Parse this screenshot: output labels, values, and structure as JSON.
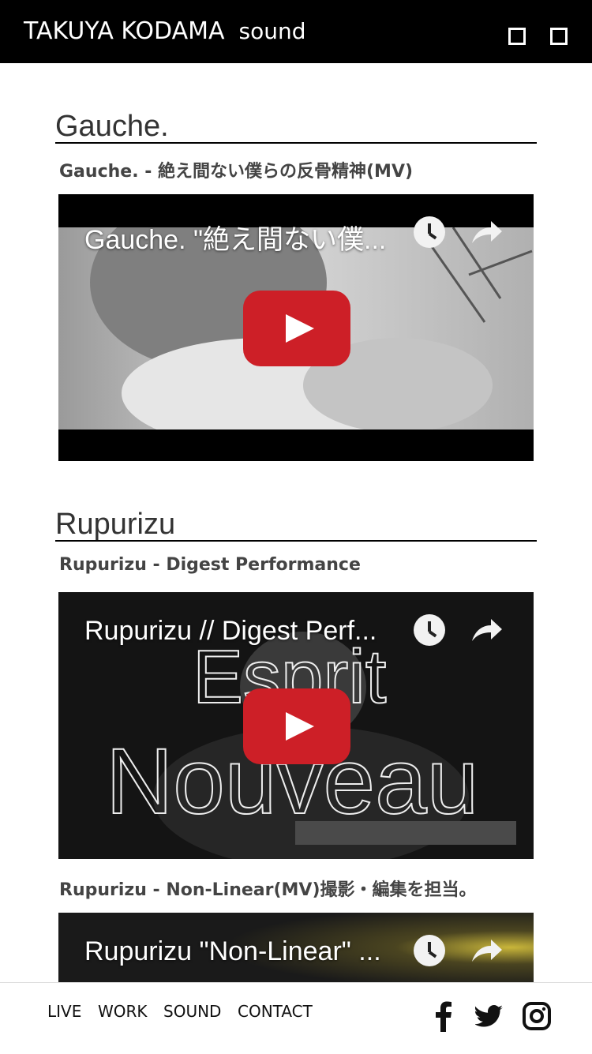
{
  "header": {
    "brand": "TAKUYA KODAMA",
    "sub": "sound"
  },
  "sections": [
    {
      "title": "Gauche.",
      "items": [
        {
          "caption": "Gauche. - 絶え間ない僕らの反骨精神(MV)",
          "video_title": "Gauche. \"絶え間ない僕..."
        }
      ]
    },
    {
      "title": "Rupurizu",
      "items": [
        {
          "caption": "Rupurizu - Digest Performance",
          "video_title": "Rupurizu // Digest Perf...",
          "overlay_1": "Esprit",
          "overlay_2": "Nouveau"
        },
        {
          "caption": "Rupurizu - Non-Linear(MV)撮影・編集を担当。",
          "video_title": "Rupurizu \"Non-Linear\" ..."
        }
      ]
    }
  ],
  "footer": {
    "nav": [
      "LIVE",
      "WORK",
      "SOUND",
      "CONTACT"
    ],
    "social": [
      "facebook-icon",
      "twitter-icon",
      "instagram-icon"
    ]
  },
  "colors": {
    "play_button": "#cd1f27",
    "header_bg": "#000000"
  }
}
